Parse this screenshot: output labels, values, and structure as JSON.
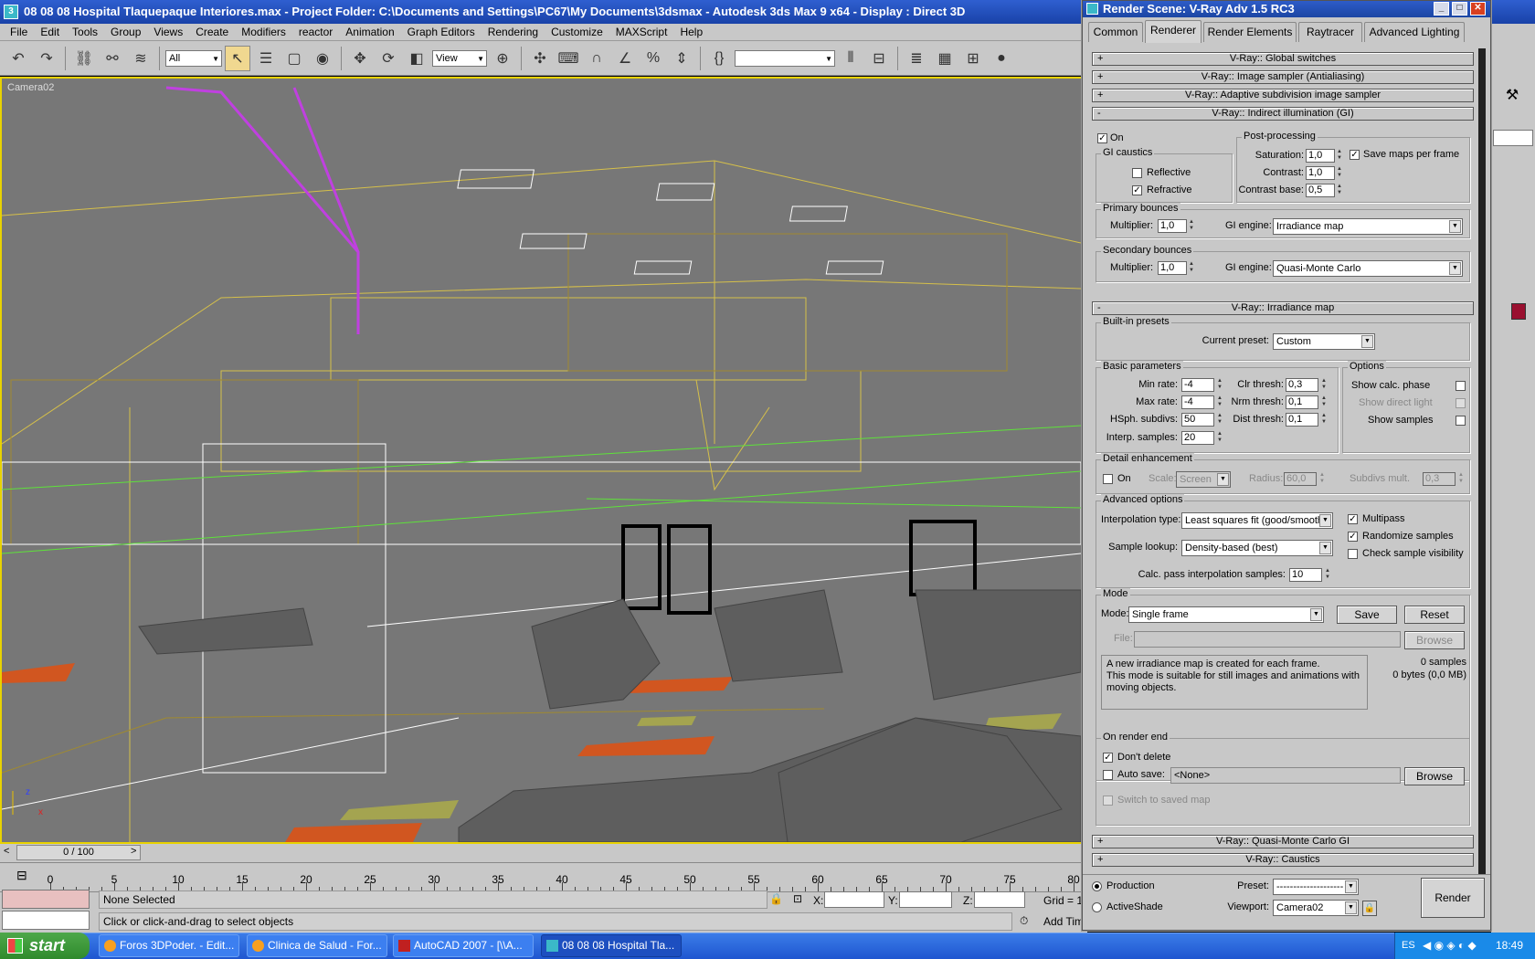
{
  "window": {
    "title": "08 08 08 Hospital Tlaquepaque Interiores.max     - Project Folder: C:\\Documents and Settings\\PC67\\My Documents\\3dsmax     - Autodesk 3ds Max 9 x64     - Display : Direct 3D"
  },
  "menu": [
    "File",
    "Edit",
    "Tools",
    "Group",
    "Views",
    "Create",
    "Modifiers",
    "reactor",
    "Animation",
    "Graph Editors",
    "Rendering",
    "Customize",
    "MAXScript",
    "Help"
  ],
  "toolbar": {
    "selection_filter": "All",
    "ref_coord": "View"
  },
  "viewport": {
    "label": "Camera02"
  },
  "timeline": {
    "slider": "0 / 100",
    "ticks": [
      "0",
      "5",
      "10",
      "15",
      "20",
      "25",
      "30",
      "35",
      "40",
      "45",
      "50",
      "55",
      "60",
      "65",
      "70",
      "75",
      "80"
    ]
  },
  "status": {
    "selection": "None Selected",
    "prompt": "Click or click-and-drag to select objects",
    "x_label": "X:",
    "y_label": "Y:",
    "z_label": "Z:",
    "grid": "Grid = 1",
    "add_time_tag": "Add Time Tag"
  },
  "taskbar": {
    "start": "start",
    "items": [
      "Foros 3DPoder. - Edit...",
      "Clinica de Salud - For...",
      "AutoCAD 2007 - [\\\\A...",
      "08 08 08 Hospital Tla..."
    ],
    "lang": "ES",
    "time": "18:49"
  },
  "render": {
    "title": "Render Scene: V-Ray Adv 1.5 RC3",
    "tabs": [
      "Common",
      "Renderer",
      "Render Elements",
      "Raytracer",
      "Advanced Lighting"
    ],
    "rollouts": {
      "global": "V-Ray:: Global switches",
      "sampler": "V-Ray:: Image sampler (Antialiasing)",
      "adaptive": "V-Ray:: Adaptive subdivision image sampler",
      "gi": "V-Ray:: Indirect illumination (GI)",
      "irr": "V-Ray:: Irradiance map",
      "qmc": "V-Ray:: Quasi-Monte Carlo GI",
      "caustics": "V-Ray:: Caustics"
    },
    "gi": {
      "on": "On",
      "caustics_group": "GI caustics",
      "reflective": "Reflective",
      "refractive": "Refractive",
      "post_group": "Post-processing",
      "saturation_label": "Saturation:",
      "saturation": "1,0",
      "contrast_label": "Contrast:",
      "contrast": "1,0",
      "contrast_base_label": "Contrast base:",
      "contrast_base": "0,5",
      "save_maps": "Save maps per frame",
      "primary_group": "Primary bounces",
      "multiplier_label": "Multiplier:",
      "primary_mult": "1,0",
      "engine_label": "GI engine:",
      "primary_engine": "Irradiance map",
      "secondary_group": "Secondary bounces",
      "secondary_mult": "1,0",
      "secondary_engine": "Quasi-Monte Carlo"
    },
    "irr": {
      "presets_group": "Built-in presets",
      "current_preset_label": "Current preset:",
      "current_preset": "Custom",
      "basic_group": "Basic parameters",
      "min_rate_label": "Min rate:",
      "min_rate": "-4",
      "max_rate_label": "Max rate:",
      "max_rate": "-4",
      "hsph_label": "HSph. subdivs:",
      "hsph": "50",
      "interp_label": "Interp. samples:",
      "interp": "20",
      "clr_label": "Clr thresh:",
      "clr": "0,3",
      "nrm_label": "Nrm thresh:",
      "nrm": "0,1",
      "dist_label": "Dist thresh:",
      "dist": "0,1",
      "options_group": "Options",
      "show_calc": "Show calc. phase",
      "show_direct": "Show direct light",
      "show_samples": "Show samples",
      "detail_group": "Detail enhancement",
      "detail_on": "On",
      "scale_label": "Scale:",
      "scale": "Screen",
      "radius_label": "Radius:",
      "radius": "60,0",
      "subdivs_label": "Subdivs mult.",
      "subdivs": "0,3",
      "adv_group": "Advanced options",
      "interp_type_label": "Interpolation type:",
      "interp_type": "Least squares fit (good/smooth",
      "lookup_label": "Sample lookup:",
      "lookup": "Density-based (best)",
      "calc_pass_label": "Calc. pass interpolation samples:",
      "calc_pass": "10",
      "multipass": "Multipass",
      "randomize": "Randomize samples",
      "check_vis": "Check sample visibility",
      "mode_group": "Mode",
      "mode_label": "Mode:",
      "mode": "Single frame",
      "save": "Save",
      "reset": "Reset",
      "file_label": "File:",
      "browse": "Browse",
      "desc": "A new irradiance map is created for each frame.\nThis mode is suitable for still images and animations with moving objects.",
      "samples": "0 samples",
      "bytes": "0 bytes (0,0 MB)",
      "end_group": "On render end",
      "dont_delete": "Don't delete",
      "auto_save": "Auto save:",
      "auto_save_path": "<None>",
      "browse2": "Browse",
      "switch_saved": "Switch to saved map"
    },
    "bottom": {
      "production": "Production",
      "activeshade": "ActiveShade",
      "preset_label": "Preset:",
      "preset": "--------------------",
      "viewport_label": "Viewport:",
      "viewport": "Camera02",
      "render": "Render"
    }
  }
}
